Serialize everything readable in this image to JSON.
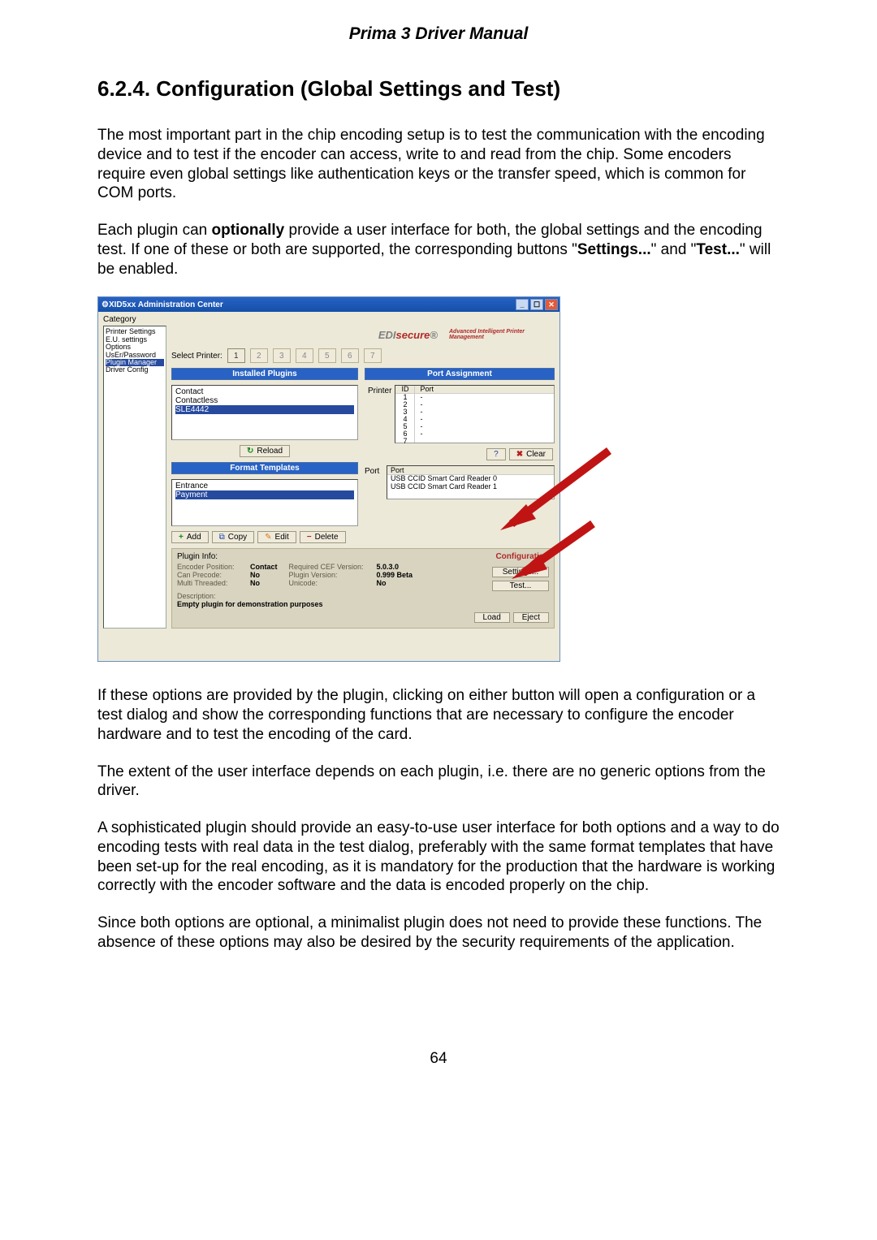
{
  "manual_title": "Prima 3 Driver Manual",
  "section_heading": "6.2.4. Configuration (Global Settings and Test)",
  "para1": "The most important part in the chip encoding setup is to test the communication with the encoding device and to test if the encoder can access, write to and read from the chip. Some encoders require even global settings like authentication keys or the transfer speed, which is common for COM ports.",
  "para2_pre": "Each plugin can ",
  "para2_bold1": "optionally",
  "para2_mid": " provide a user interface for both, the global settings and the encoding test. If one of these or both are supported, the corresponding buttons \"",
  "para2_bold2": "Settings...",
  "para2_mid2": "\" and \"",
  "para2_bold3": "Test...",
  "para2_end": "\" will be enabled.",
  "para3": "If these options are provided by the plugin, clicking on either button will open a configuration or a test dialog and show the corresponding functions that are necessary to configure the encoder hardware and to test the encoding of the card.",
  "para4": "The extent of the user interface depends on each plugin, i.e. there are no generic options from the driver.",
  "para5": "A sophisticated plugin should provide an easy-to-use user interface for both options and a way to do encoding tests with real data in the test dialog, preferably with the same format templates that have been set-up for the real encoding, as it is mandatory for the production that the hardware is working correctly with the encoder software and the data is encoded properly on the chip.",
  "para6": "Since both options are optional, a minimalist plugin does not need to provide these functions. The absence of these options may also be desired by the security requirements of the application.",
  "page_number": "64",
  "win": {
    "title": "XID5xx Administration Center",
    "category_label": "Category",
    "sidebar": {
      "items": [
        "Printer Settings",
        "E.U. settings",
        "Options",
        "UsEr/Password",
        "Plugin Manager",
        "Driver Config"
      ],
      "selected": "Plugin Manager"
    },
    "brand": {
      "prefix": "EDI",
      "suffix": "secure",
      "reg": "®",
      "tagline": "Advanced Intelligent Printer Management"
    },
    "printer_row": {
      "label": "Select Printer:",
      "tabs": [
        "1",
        "2",
        "3",
        "4",
        "5",
        "6",
        "7"
      ]
    },
    "installed_plugins": {
      "header": "Installed Plugins",
      "items": [
        "Contact",
        "Contactless",
        "SLE4442"
      ],
      "selected": "SLE4442",
      "reload": "Reload"
    },
    "port_assignment": {
      "header": "Port Assignment",
      "printer_label": "Printer",
      "id_header": "ID",
      "port_header": "Port",
      "ids": [
        "1",
        "2",
        "3",
        "4",
        "5",
        "6",
        "7"
      ],
      "ports": [
        "",
        "-",
        "-",
        "-",
        "-",
        "-",
        "-"
      ],
      "question_btn": "?",
      "clear_btn": "Clear",
      "port_label": "Port",
      "port_box_header": "Port",
      "port_rows": [
        "USB CCID Smart Card Reader 0",
        "USB CCID Smart Card Reader 1"
      ]
    },
    "format_templates": {
      "header": "Format Templates",
      "items": [
        "Entrance",
        "Payment"
      ],
      "selected": "Payment",
      "add": "Add",
      "copy": "Copy",
      "edit": "Edit",
      "delete": "Delete"
    },
    "plugin_info": {
      "title": "Plugin Info:",
      "config_label": "Configuration",
      "rows": [
        {
          "k": "Encoder Position:",
          "v": "Contact"
        },
        {
          "k": "Can Precode:",
          "v": "No"
        },
        {
          "k": "Multi Threaded:",
          "v": "No"
        }
      ],
      "rows_right": [
        {
          "k": "Required CEF Version:",
          "v": "5.0.3.0"
        },
        {
          "k": "Plugin Version:",
          "v": "0.999 Beta"
        },
        {
          "k": "Unicode:",
          "v": "No"
        }
      ],
      "desc_label": "Description:",
      "desc": "Empty plugin for demonstration purposes",
      "settings_btn": "Settings...",
      "test_btn": "Test...",
      "load_btn": "Load",
      "eject_btn": "Eject"
    }
  }
}
